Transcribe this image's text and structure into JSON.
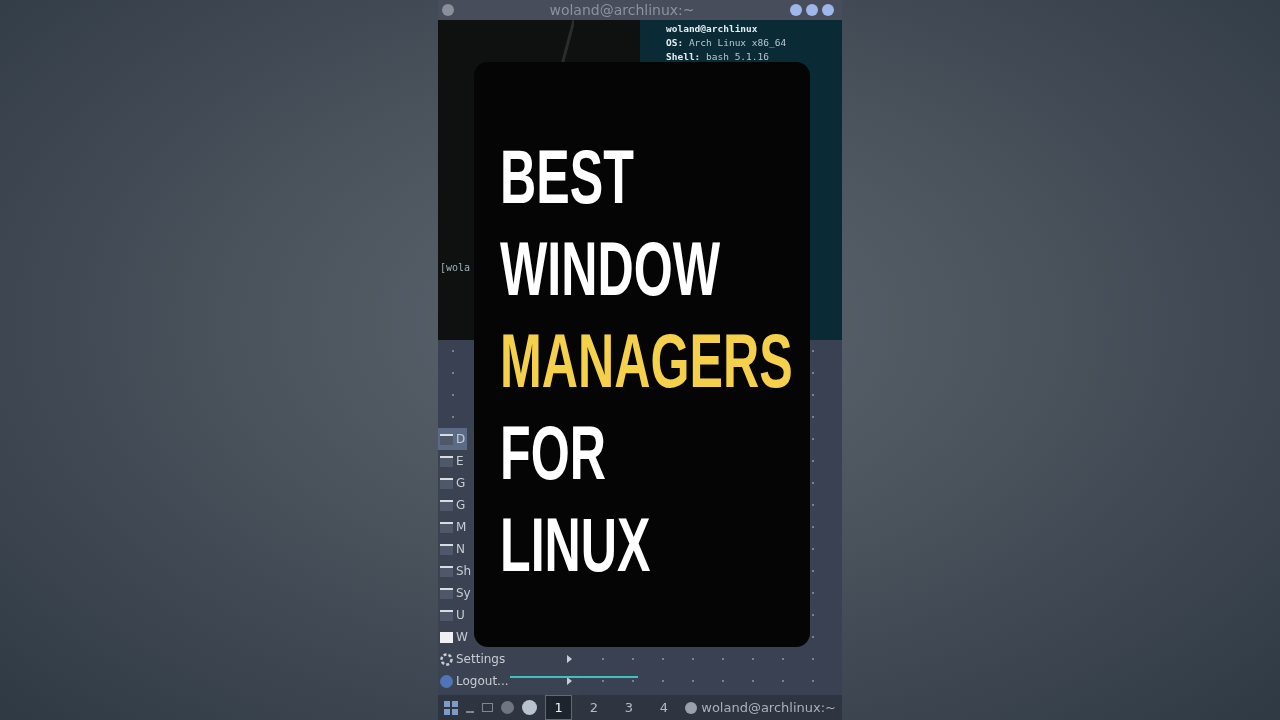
{
  "window": {
    "title": "woland@archlinux:~"
  },
  "terminal": {
    "lines": [
      {
        "kind": "host",
        "text": "woland@archlinux"
      },
      {
        "kind": "info",
        "text": "**OS:** Arch Linux x86_64"
      },
      {
        "kind": "info",
        "text": "**Shell:** bash 5.1.16"
      }
    ],
    "prompt": "[wola"
  },
  "menu": {
    "items": [
      {
        "kind": "folder",
        "label": "D",
        "selected": true
      },
      {
        "kind": "folder",
        "label": "E",
        "selected": false
      },
      {
        "kind": "folder",
        "label": "G",
        "selected": false
      },
      {
        "kind": "folder",
        "label": "G",
        "selected": false
      },
      {
        "kind": "folder",
        "label": "M",
        "selected": false
      },
      {
        "kind": "folder",
        "label": "N",
        "selected": false
      },
      {
        "kind": "folder",
        "label": "Sh",
        "selected": false
      },
      {
        "kind": "folder",
        "label": "Sy",
        "selected": false
      },
      {
        "kind": "folder",
        "label": "U",
        "selected": false
      },
      {
        "kind": "window",
        "label": "W",
        "selected": false
      },
      {
        "kind": "settings",
        "label": "Settings",
        "selected": false,
        "submenu": true
      },
      {
        "kind": "logout",
        "label": "Logout...",
        "selected": false,
        "submenu": true
      }
    ]
  },
  "taskbar": {
    "workspaces": [
      {
        "label": "1",
        "selected": true
      },
      {
        "label": "2",
        "selected": false
      },
      {
        "label": "3",
        "selected": false
      },
      {
        "label": "4",
        "selected": false
      }
    ],
    "task": "woland@archlinux:~"
  },
  "overlay": {
    "lines": [
      {
        "text": "BEST",
        "color": "#ffffff"
      },
      {
        "text": "WINDOW",
        "color": "#ffffff"
      },
      {
        "text": "MANAGERS",
        "color": "#f5d04a"
      },
      {
        "text": "FOR",
        "color": "#ffffff"
      },
      {
        "text": "LINUX",
        "color": "#ffffff"
      }
    ]
  }
}
